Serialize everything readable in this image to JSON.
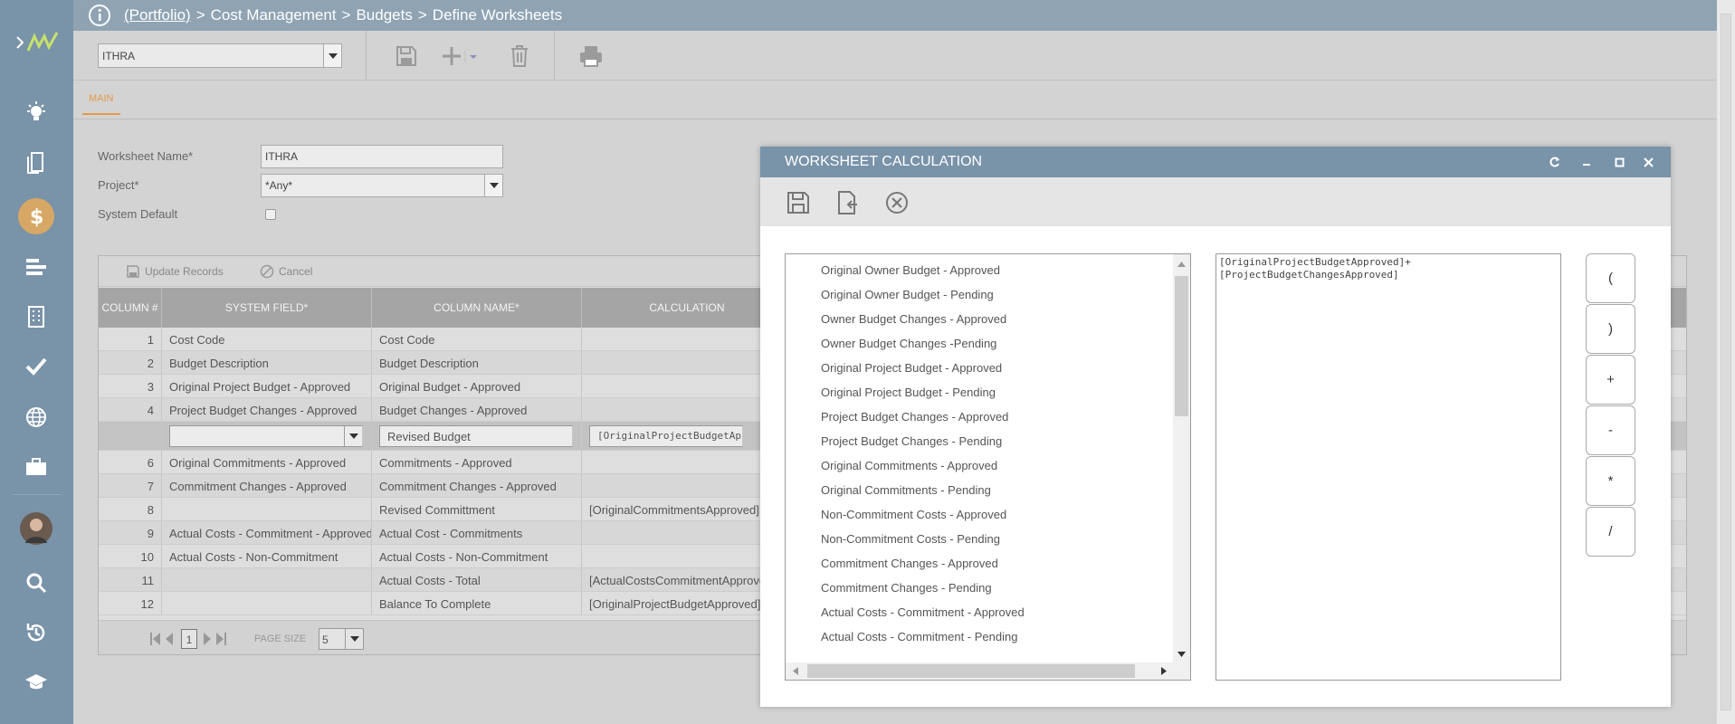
{
  "breadcrumb": {
    "root": "(Portfolio)",
    "separator": ">",
    "items": [
      "Cost Management",
      "Budgets",
      "Define Worksheets"
    ]
  },
  "toolbar": {
    "worksheet_select": "ITHRA"
  },
  "tabs": [
    {
      "label": "MAIN"
    }
  ],
  "form": {
    "worksheet_name_label": "Worksheet Name*",
    "worksheet_name_value": "ITHRA",
    "project_label": "Project*",
    "project_value": "*Any*",
    "system_default_label": "System Default"
  },
  "grid": {
    "update_records_label": "Update Records",
    "cancel_label": "Cancel",
    "columns": [
      "COLUMN #",
      "SYSTEM FIELD*",
      "COLUMN NAME*",
      "CALCULATION"
    ],
    "rows": [
      {
        "num": "1",
        "system_field": "Cost Code",
        "column_name": "Cost Code",
        "calculation": ""
      },
      {
        "num": "2",
        "system_field": "Budget Description",
        "column_name": "Budget Description",
        "calculation": ""
      },
      {
        "num": "3",
        "system_field": "Original Project Budget - Approved",
        "column_name": "Original Budget - Approved",
        "calculation": ""
      },
      {
        "num": "4",
        "system_field": "Project Budget Changes - Approved",
        "column_name": "Budget Changes - Approved",
        "calculation": ""
      }
    ],
    "edit_row": {
      "system_field": "",
      "column_name": "Revised Budget",
      "calculation": "[OriginalProjectBudgetApproved]+"
    },
    "rows_after": [
      {
        "num": "6",
        "system_field": "Original Commitments - Approved",
        "column_name": "Commitments - Approved",
        "calculation": ""
      },
      {
        "num": "7",
        "system_field": "Commitment Changes - Approved",
        "column_name": "Commitment Changes - Approved",
        "calculation": ""
      },
      {
        "num": "8",
        "system_field": "",
        "column_name": "Revised Committment",
        "calculation": "[OriginalCommitmentsApproved]"
      },
      {
        "num": "9",
        "system_field": "Actual Costs - Commitment - Approved",
        "column_name": "Actual Cost - Commitments",
        "calculation": ""
      },
      {
        "num": "10",
        "system_field": "Actual Costs - Non-Commitment",
        "column_name": "Actual Costs - Non-Commitment",
        "calculation": ""
      },
      {
        "num": "11",
        "system_field": "",
        "column_name": "Actual Costs - Total",
        "calculation": "[ActualCostsCommitmentApproved]"
      },
      {
        "num": "12",
        "system_field": "",
        "column_name": "Balance To Complete",
        "calculation": "[OriginalProjectBudgetApproved]"
      }
    ],
    "pager": {
      "page": "1",
      "page_size_label": "PAGE SIZE",
      "page_size": "5"
    }
  },
  "modal": {
    "title": "WORKSHEET CALCULATION",
    "fields": [
      "Original Owner Budget - Approved",
      "Original Owner Budget - Pending",
      "Owner Budget Changes - Approved",
      "Owner Budget Changes -Pending",
      "Original Project Budget - Approved",
      "Original Project Budget - Pending",
      "Project Budget Changes - Approved",
      "Project Budget Changes - Pending",
      "Original Commitments - Approved",
      "Original Commitments - Pending",
      "Non-Commitment Costs - Approved",
      "Non-Commitment Costs - Pending",
      "Commitment Changes - Approved",
      "Commitment Changes - Pending",
      "Actual Costs - Commitment - Approved",
      "Actual Costs - Commitment - Pending"
    ],
    "formula": "[OriginalProjectBudgetApproved]+\n[ProjectBudgetChangesApproved]",
    "operators": [
      "(",
      ")",
      "+",
      "-",
      "*",
      "/"
    ]
  },
  "colors": {
    "rail": "#7993a9",
    "accent": "#e39a4a",
    "dollar": "#d7a865",
    "modal_header": "#7993a9"
  }
}
